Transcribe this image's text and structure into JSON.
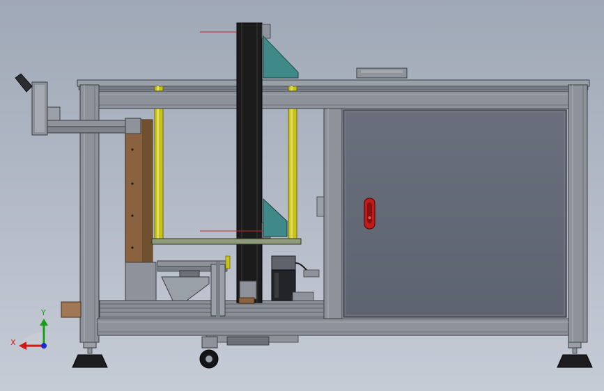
{
  "view": {
    "background_top": "#9fa8b6",
    "background_bottom": "#c6ccd6"
  },
  "triad": {
    "x_label": "X",
    "y_label": "Y",
    "x_color": "#d01818",
    "y_color": "#14a014",
    "z_color": "#1a2ad0"
  },
  "colors": {
    "frame": "#8e939b",
    "frame_edge": "#3a3d42",
    "panel": "#666b78",
    "column": "#1b1b1b",
    "rod": "#c9c21c",
    "bracket": "#3f8a88",
    "plate": "#8d9a7c",
    "wood": "#8a6240",
    "handle": "#c01b1b",
    "centerline": "#c0282c"
  },
  "components": [
    {
      "name": "top-plate"
    },
    {
      "name": "upper-beam"
    },
    {
      "name": "lower-beam"
    },
    {
      "name": "left-post"
    },
    {
      "name": "right-post"
    },
    {
      "name": "vertical-column"
    },
    {
      "name": "guide-rod-left"
    },
    {
      "name": "guide-rod-right"
    },
    {
      "name": "upper-bracket"
    },
    {
      "name": "lower-bracket"
    },
    {
      "name": "wood-backboard"
    },
    {
      "name": "carriage-plate"
    },
    {
      "name": "servo-motor"
    },
    {
      "name": "cabinet-door"
    },
    {
      "name": "door-handle"
    },
    {
      "name": "hand-wheel"
    },
    {
      "name": "leveling-foot-left"
    },
    {
      "name": "leveling-foot-right"
    },
    {
      "name": "caster-wheel"
    }
  ]
}
